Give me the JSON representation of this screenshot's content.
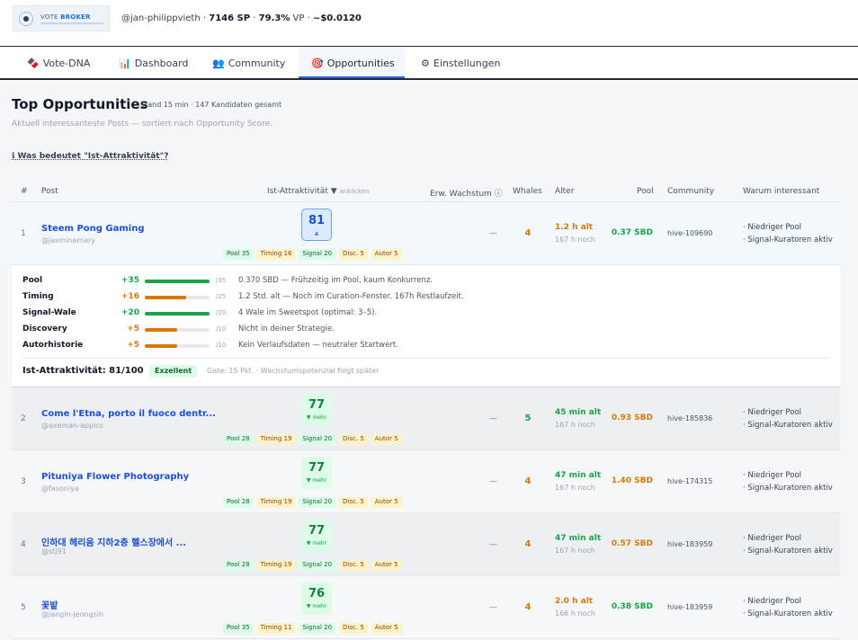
{
  "header": {
    "logo": {
      "text_a": "VOTE ",
      "text_b": "BROKER"
    },
    "user": "@jan-philippvieth",
    "sep1": " · ",
    "sp": "7146 SP",
    "sep2": " · ",
    "vp": "79.3%",
    "vp_label": " VP · ",
    "value": "~$0.0120"
  },
  "tabs": [
    {
      "icon": "🍫",
      "label": "Vote-DNA"
    },
    {
      "icon": "📊",
      "label": "Dashboard"
    },
    {
      "icon": "👥",
      "label": "Community"
    },
    {
      "icon": "🎯",
      "label": "Opportunities"
    },
    {
      "icon": "⚙",
      "label": "Einstellungen"
    }
  ],
  "page": {
    "title": "Top Opportunities",
    "meta": "Stand 15 min · 147 Kandidaten gesamt",
    "subtitle": "Aktuell interessanteste Posts — sortiert nach Opportunity Score.",
    "info_link": "ℹ Was bedeutet \"Ist-Attraktivität\"?"
  },
  "table": {
    "headers": {
      "rank": "#",
      "post": "Post",
      "score": "Ist-Attraktivität ▼",
      "score_hint": "anklicken",
      "growth": "Erw. Wachstum ⓘ",
      "whales": "Whales",
      "age": "Alter",
      "pool": "Pool",
      "community": "Community",
      "why": "Warum interessant"
    },
    "rows": [
      {
        "rank": "1",
        "title": "Steem Pong Gaming",
        "author": "@jasminemary",
        "score": "81",
        "score_sub": "▲",
        "pills": [
          "Pool 35",
          "Timing 16",
          "Signal 20",
          "Disc. 5",
          "Autor 5"
        ],
        "growth": "—",
        "whales": "4",
        "age": "1.2 h alt",
        "remaining": "167 h noch",
        "pool": "0.37 SBD",
        "community": "hive-109690",
        "why1": "· Niedriger Pool",
        "why2": "· Signal-Kuratoren aktiv"
      },
      {
        "rank": "2",
        "title": "Come l'Etna, porto il fuoco dentr...",
        "author": "@axeman-appics",
        "score": "77",
        "score_sub": "▼ mehr",
        "pills": [
          "Pool 28",
          "Timing 19",
          "Signal 20",
          "Disc. 5",
          "Autor 5"
        ],
        "growth": "—",
        "whales": "5",
        "age": "45 min alt",
        "remaining": "167 h noch",
        "pool": "0.93 SBD",
        "community": "hive-185836",
        "why1": "· Niedriger Pool",
        "why2": "· Signal-Kuratoren aktiv"
      },
      {
        "rank": "3",
        "title": "Pituniya Flower Photography",
        "author": "@fasoniya",
        "score": "77",
        "score_sub": "▼ mehr",
        "pills": [
          "Pool 28",
          "Timing 19",
          "Signal 20",
          "Disc. 5",
          "Autor 5"
        ],
        "growth": "—",
        "whales": "4",
        "age": "47 min alt",
        "remaining": "167 h noch",
        "pool": "1.40 SBD",
        "community": "hive-174315",
        "why1": "· Niedriger Pool",
        "why2": "· Signal-Kuratoren aktiv"
      },
      {
        "rank": "4",
        "title": "인하대 헤리움 지하2층 헬스장에서 ...",
        "author": "@stj91",
        "score": "77",
        "score_sub": "▼ mehr",
        "pills": [
          "Pool 28",
          "Timing 19",
          "Signal 20",
          "Disc. 5",
          "Autor 5"
        ],
        "growth": "—",
        "whales": "4",
        "age": "47 min alt",
        "remaining": "167 h noch",
        "pool": "0.57 SBD",
        "community": "hive-183959",
        "why1": "· Niedriger Pool",
        "why2": "· Signal-Kuratoren aktiv"
      },
      {
        "rank": "5",
        "title": "꽃밭",
        "author": "@jangin-jeongsin",
        "score": "76",
        "score_sub": "▼ mehr",
        "pills": [
          "Pool 35",
          "Timing 11",
          "Signal 20",
          "Disc. 5",
          "Autor 5"
        ],
        "growth": "—",
        "whales": "4",
        "age": "2.0 h alt",
        "remaining": "166 h noch",
        "pool": "0.38 SBD",
        "community": "hive-183959",
        "why1": "· Niedriger Pool",
        "why2": "· Signal-Kuratoren aktiv"
      }
    ]
  },
  "detail": {
    "items": [
      {
        "label": "Pool",
        "points": "+35",
        "fraction": 1.0,
        "max": "/35",
        "text": "0.370 SBD — Frühzeitig im Pool, kaum Konkurrenz."
      },
      {
        "label": "Timing",
        "points": "+16",
        "fraction": 0.64,
        "max": "/25",
        "text": "1.2 Std. alt — Noch im Curation-Fenster. 167h Restlaufzeit."
      },
      {
        "label": "Signal-Wale",
        "points": "+20",
        "fraction": 1.0,
        "max": "/20",
        "text": "4 Wale im Sweetspot (optimal: 3–5)."
      },
      {
        "label": "Discovery",
        "points": "+5",
        "fraction": 0.5,
        "max": "/10",
        "text": "Nicht in deiner Strategie."
      },
      {
        "label": "Autorhistorie",
        "points": "+5",
        "fraction": 0.5,
        "max": "/10",
        "text": "Kein Verlaufsdaten — neutraler Startwert."
      }
    ],
    "total": "Ist-Attraktivität: 81/100",
    "badge": "Exzellent",
    "gate": "Gate: 15 Pkt. · Wachstumspotenzial folgt später"
  },
  "colors": {
    "accent": "#2563eb",
    "link": "#1d4ed8",
    "good": "#16a34a",
    "warn": "#d97706"
  }
}
